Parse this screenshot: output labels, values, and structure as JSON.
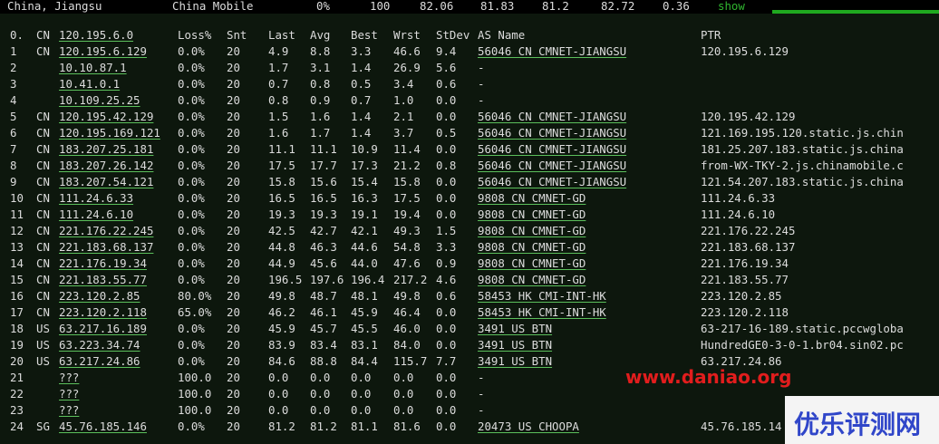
{
  "top": {
    "location": "China, Jiangsu",
    "isp": "China Mobile",
    "loss": "0%",
    "snt": "100",
    "last": "82.06",
    "avg": "81.83",
    "best": "81.2",
    "wrst": "82.72",
    "stdev": "0.36",
    "show_label": "show"
  },
  "header": {
    "hop": "0.",
    "cc": "CN",
    "ip": "120.195.6.0",
    "loss": "Loss%",
    "snt": "Snt",
    "last": "Last",
    "avg": "Avg",
    "best": "Best",
    "wrst": "Wrst",
    "stdev": "StDev",
    "as": "AS Name",
    "ptr": "PTR"
  },
  "rows": [
    {
      "hop": "1",
      "cc": "CN",
      "ip": "120.195.6.129",
      "loss": "0.0%",
      "snt": "20",
      "last": "4.9",
      "avg": "8.8",
      "best": "3.3",
      "wrst": "46.6",
      "stdev": "9.4",
      "as": "56046 CN CMNET-JIANGSU",
      "ptr": "120.195.6.129"
    },
    {
      "hop": "2",
      "cc": "",
      "ip": "10.10.87.1",
      "loss": "0.0%",
      "snt": "20",
      "last": "1.7",
      "avg": "3.1",
      "best": "1.4",
      "wrst": "26.9",
      "stdev": "5.6",
      "as": "-",
      "ptr": ""
    },
    {
      "hop": "3",
      "cc": "",
      "ip": "10.41.0.1",
      "loss": "0.0%",
      "snt": "20",
      "last": "0.7",
      "avg": "0.8",
      "best": "0.5",
      "wrst": "3.4",
      "stdev": "0.6",
      "as": "-",
      "ptr": ""
    },
    {
      "hop": "4",
      "cc": "",
      "ip": "10.109.25.25",
      "loss": "0.0%",
      "snt": "20",
      "last": "0.8",
      "avg": "0.9",
      "best": "0.7",
      "wrst": "1.0",
      "stdev": "0.0",
      "as": "-",
      "ptr": ""
    },
    {
      "hop": "5",
      "cc": "CN",
      "ip": "120.195.42.129",
      "loss": "0.0%",
      "snt": "20",
      "last": "1.5",
      "avg": "1.6",
      "best": "1.4",
      "wrst": "2.1",
      "stdev": "0.0",
      "as": "56046 CN CMNET-JIANGSU",
      "ptr": "120.195.42.129"
    },
    {
      "hop": "6",
      "cc": "CN",
      "ip": "120.195.169.121",
      "loss": "0.0%",
      "snt": "20",
      "last": "1.6",
      "avg": "1.7",
      "best": "1.4",
      "wrst": "3.7",
      "stdev": "0.5",
      "as": "56046 CN CMNET-JIANGSU",
      "ptr": "121.169.195.120.static.js.chin"
    },
    {
      "hop": "7",
      "cc": "CN",
      "ip": "183.207.25.181",
      "loss": "0.0%",
      "snt": "20",
      "last": "11.1",
      "avg": "11.1",
      "best": "10.9",
      "wrst": "11.4",
      "stdev": "0.0",
      "as": "56046 CN CMNET-JIANGSU",
      "ptr": "181.25.207.183.static.js.china"
    },
    {
      "hop": "8",
      "cc": "CN",
      "ip": "183.207.26.142",
      "loss": "0.0%",
      "snt": "20",
      "last": "17.5",
      "avg": "17.7",
      "best": "17.3",
      "wrst": "21.2",
      "stdev": "0.8",
      "as": "56046 CN CMNET-JIANGSU",
      "ptr": "from-WX-TKY-2.js.chinamobile.c"
    },
    {
      "hop": "9",
      "cc": "CN",
      "ip": "183.207.54.121",
      "loss": "0.0%",
      "snt": "20",
      "last": "15.8",
      "avg": "15.6",
      "best": "15.4",
      "wrst": "15.8",
      "stdev": "0.0",
      "as": "56046 CN CMNET-JIANGSU",
      "ptr": "121.54.207.183.static.js.china"
    },
    {
      "hop": "10",
      "cc": "CN",
      "ip": "111.24.6.33",
      "loss": "0.0%",
      "snt": "20",
      "last": "16.5",
      "avg": "16.5",
      "best": "16.3",
      "wrst": "17.5",
      "stdev": "0.0",
      "as": "9808  CN CMNET-GD",
      "ptr": "111.24.6.33"
    },
    {
      "hop": "11",
      "cc": "CN",
      "ip": "111.24.6.10",
      "loss": "0.0%",
      "snt": "20",
      "last": "19.3",
      "avg": "19.3",
      "best": "19.1",
      "wrst": "19.4",
      "stdev": "0.0",
      "as": "9808  CN CMNET-GD",
      "ptr": "111.24.6.10"
    },
    {
      "hop": "12",
      "cc": "CN",
      "ip": "221.176.22.245",
      "loss": "0.0%",
      "snt": "20",
      "last": "42.5",
      "avg": "42.7",
      "best": "42.1",
      "wrst": "49.3",
      "stdev": "1.5",
      "as": "9808  CN CMNET-GD",
      "ptr": "221.176.22.245"
    },
    {
      "hop": "13",
      "cc": "CN",
      "ip": "221.183.68.137",
      "loss": "0.0%",
      "snt": "20",
      "last": "44.8",
      "avg": "46.3",
      "best": "44.6",
      "wrst": "54.8",
      "stdev": "3.3",
      "as": "9808  CN CMNET-GD",
      "ptr": "221.183.68.137"
    },
    {
      "hop": "14",
      "cc": "CN",
      "ip": "221.176.19.34",
      "loss": "0.0%",
      "snt": "20",
      "last": "44.9",
      "avg": "45.6",
      "best": "44.0",
      "wrst": "47.6",
      "stdev": "0.9",
      "as": "9808  CN CMNET-GD",
      "ptr": "221.176.19.34"
    },
    {
      "hop": "15",
      "cc": "CN",
      "ip": "221.183.55.77",
      "loss": "0.0%",
      "snt": "20",
      "last": "196.5",
      "avg": "197.6",
      "best": "196.4",
      "wrst": "217.2",
      "stdev": "4.6",
      "as": "9808  CN CMNET-GD",
      "ptr": "221.183.55.77"
    },
    {
      "hop": "16",
      "cc": "CN",
      "ip": "223.120.2.85",
      "loss": "80.0%",
      "snt": "20",
      "last": "49.8",
      "avg": "48.7",
      "best": "48.1",
      "wrst": "49.8",
      "stdev": "0.6",
      "as": "58453 HK CMI-INT-HK",
      "ptr": "223.120.2.85"
    },
    {
      "hop": "17",
      "cc": "CN",
      "ip": "223.120.2.118",
      "loss": "65.0%",
      "snt": "20",
      "last": "46.2",
      "avg": "46.1",
      "best": "45.9",
      "wrst": "46.4",
      "stdev": "0.0",
      "as": "58453 HK CMI-INT-HK",
      "ptr": "223.120.2.118"
    },
    {
      "hop": "18",
      "cc": "US",
      "ip": "63.217.16.189",
      "loss": "0.0%",
      "snt": "20",
      "last": "45.9",
      "avg": "45.7",
      "best": "45.5",
      "wrst": "46.0",
      "stdev": "0.0",
      "as": "3491  US BTN",
      "ptr": "63-217-16-189.static.pccwgloba"
    },
    {
      "hop": "19",
      "cc": "US",
      "ip": "63.223.34.74",
      "loss": "0.0%",
      "snt": "20",
      "last": "83.9",
      "avg": "83.4",
      "best": "83.1",
      "wrst": "84.0",
      "stdev": "0.0",
      "as": "3491  US BTN",
      "ptr": "HundredGE0-3-0-1.br04.sin02.pc"
    },
    {
      "hop": "20",
      "cc": "US",
      "ip": "63.217.24.86",
      "loss": "0.0%",
      "snt": "20",
      "last": "84.6",
      "avg": "88.8",
      "best": "84.4",
      "wrst": "115.7",
      "stdev": "7.7",
      "as": "3491  US BTN",
      "ptr": "63.217.24.86"
    },
    {
      "hop": "21",
      "cc": "",
      "ip": "???",
      "loss": "100.0",
      "snt": "20",
      "last": "0.0",
      "avg": "0.0",
      "best": "0.0",
      "wrst": "0.0",
      "stdev": "0.0",
      "as": "-",
      "ptr": ""
    },
    {
      "hop": "22",
      "cc": "",
      "ip": "???",
      "loss": "100.0",
      "snt": "20",
      "last": "0.0",
      "avg": "0.0",
      "best": "0.0",
      "wrst": "0.0",
      "stdev": "0.0",
      "as": "-",
      "ptr": ""
    },
    {
      "hop": "23",
      "cc": "",
      "ip": "???",
      "loss": "100.0",
      "snt": "20",
      "last": "0.0",
      "avg": "0.0",
      "best": "0.0",
      "wrst": "0.0",
      "stdev": "0.0",
      "as": "-",
      "ptr": ""
    },
    {
      "hop": "24",
      "cc": "SG",
      "ip": "45.76.185.146",
      "loss": "0.0%",
      "snt": "20",
      "last": "81.2",
      "avg": "81.2",
      "best": "81.1",
      "wrst": "81.6",
      "stdev": "0.0",
      "as": "20473 US CHOOPA",
      "ptr": "45.76.185.14"
    }
  ],
  "watermark": "www.daniao.org",
  "brand_logo": "优乐评测网",
  "colors": {
    "panel_bg": "#0d170d",
    "text": "#dcdcdc",
    "link_underline": "#5bbf5b",
    "show": "#2fb52f",
    "watermark": "#e11d1d",
    "brand": "#3046c9"
  }
}
